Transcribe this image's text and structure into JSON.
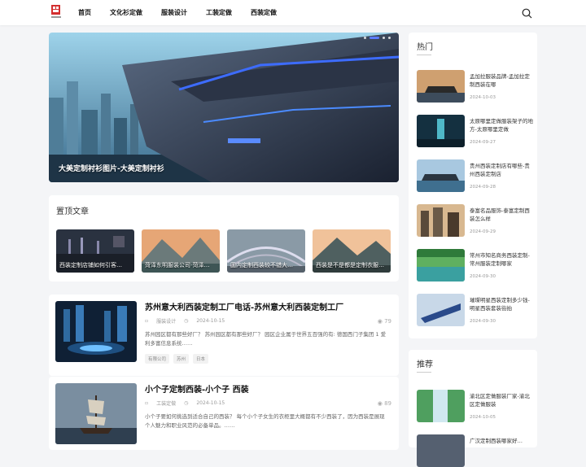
{
  "nav": {
    "links": [
      "首页",
      "文化衫定做",
      "服装设计",
      "工装定做",
      "西装定做"
    ]
  },
  "slider": {
    "caption": "大美定制衬衫图片-大美定制衬衫"
  },
  "pinned": {
    "title": "置顶文章",
    "items": [
      "西装定制店铺如何引客…",
      "菏泽东明服装公司-菏泽…",
      "国内定制西装较不错大…",
      "西装是不是都是定制衣服…"
    ]
  },
  "articles": [
    {
      "title": "苏州意大利西装定制工厂电话-苏州意大利西装定制工厂",
      "category": "服装设计",
      "date": "2024-10-15",
      "views": "79",
      "excerpt": "苏州园区都有那些好厂？ 苏州园区都有那些好厂？ 园区企业属于世界五百强的有: 德国西门子集团 1 爱利多富信息系统……",
      "tags": [
        "有限公司",
        "苏州",
        "日本"
      ]
    },
    {
      "title": "小个子定制西装-小个子 西装",
      "category": "工装定做",
      "date": "2024-10-15",
      "views": "89",
      "excerpt": "小个子要如何挑选到适合自己的西装？ 每个小个子女生的衣柜里大概都有不少西装了，因为西装是展现个人魅力和职业风范的必备单品。……",
      "tags": []
    }
  ],
  "hot": {
    "title": "热门",
    "items": [
      {
        "text": "孟加拉服装品牌-孟加拉定制西装在哪",
        "date": "2024-10-03"
      },
      {
        "text": "太原哪里定做服装架子的地方-太原哪里定做",
        "date": "2024-09-27"
      },
      {
        "text": "贵州西装定制店有哪些-贵州西装定制店",
        "date": "2024-09-28"
      },
      {
        "text": "泰富名品服饰-泰富定制西装怎么样",
        "date": "2024-09-29"
      },
      {
        "text": "常州市知名商务西装定制-常州服装定制哪家",
        "date": "2024-09-30"
      },
      {
        "text": "璀璨明星西装定制多少钱-明星西装套装街拍",
        "date": "2024-09-30"
      }
    ]
  },
  "recommend": {
    "title": "推荐",
    "items": [
      {
        "text": "渝北区定做服装厂家-渝北区定做服装",
        "date": "2024-10-05"
      },
      {
        "text": "广汉定制西装哪家好…",
        "date": ""
      }
    ]
  },
  "colors": {
    "accent": "#5b7cff",
    "logo": "#d32f2f"
  }
}
